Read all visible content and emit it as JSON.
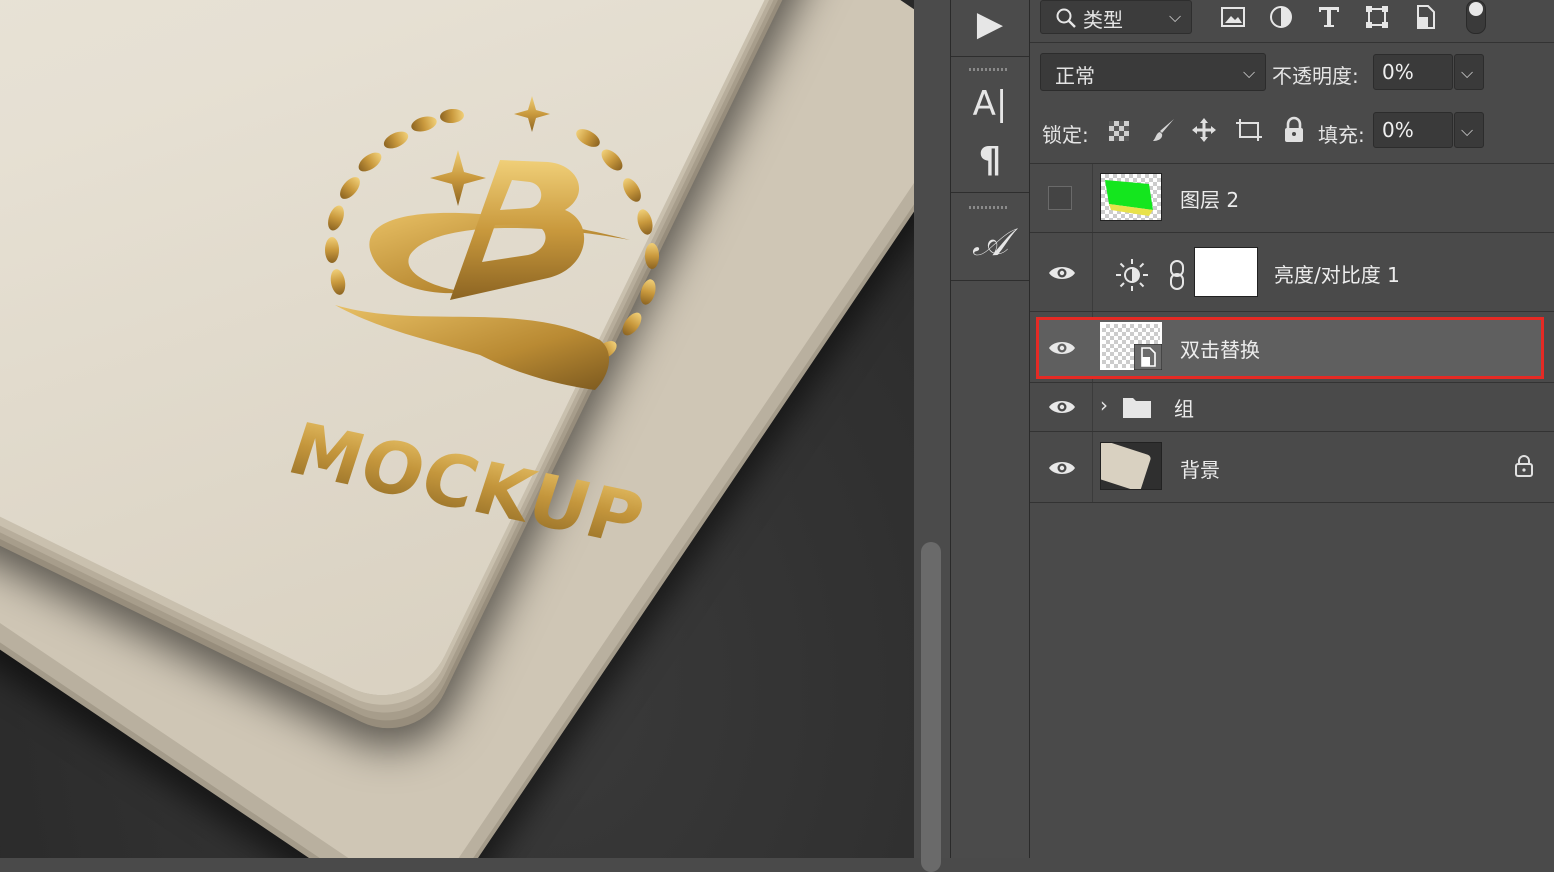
{
  "canvas": {
    "mockup_text": "MOCKUP"
  },
  "tools": {
    "play": "▶",
    "char": "A|",
    "para": "¶",
    "glyph": "𝒜"
  },
  "panel": {
    "filter": {
      "kind_label": "类型"
    },
    "blend_mode": "正常",
    "opacity_label": "不透明度:",
    "opacity_value": "0%",
    "lock_label": "锁定:",
    "fill_label": "填充:",
    "fill_value": "0%",
    "layers": [
      {
        "name": "图层 2",
        "visible": false
      },
      {
        "name": "亮度/对比度 1",
        "visible": true
      },
      {
        "name": "双击替换",
        "visible": true,
        "selected": true
      },
      {
        "name": "组",
        "visible": true
      },
      {
        "name": "背景",
        "visible": true,
        "locked": true
      }
    ]
  },
  "colors": {
    "panel_bg": "#4a4a4a",
    "selected_row": "#5f5f5f",
    "highlight": "#e52a24",
    "gold": "#c79a3f",
    "paper": "#eee9df",
    "green_thumb": "#14e61e"
  }
}
